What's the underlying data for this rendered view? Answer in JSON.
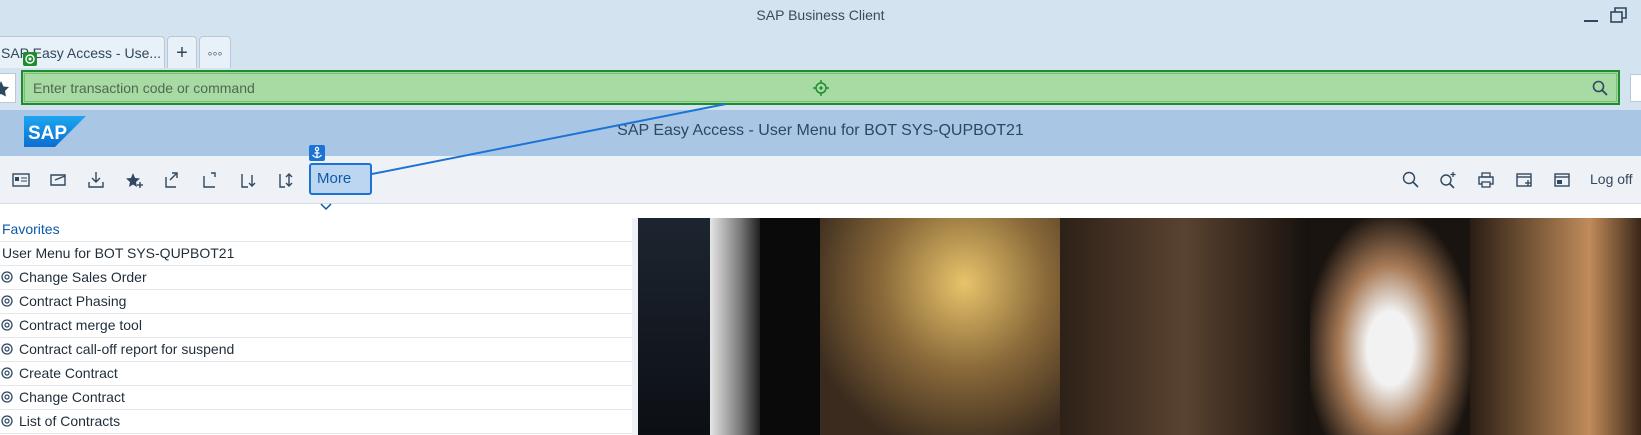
{
  "window": {
    "title": "SAP Business Client",
    "minimize_icon": "minimize-icon",
    "maximize_icon": "restore-icon"
  },
  "tabs": [
    {
      "label": "SAP Easy Access  -  Use..."
    },
    {
      "label": "+"
    },
    {
      "label": "◦◦◦"
    }
  ],
  "command": {
    "placeholder": "Enter transaction code or command",
    "search_icon": "search-icon",
    "target_icon": "target-icon"
  },
  "header": {
    "logo": "SAP",
    "title": "SAP Easy Access  -  User Menu for BOT SYS-QUPBOT21"
  },
  "toolbar": {
    "more_label": "More",
    "logoff_label": "Log off",
    "left_icons": [
      "user-menu-icon",
      "sap-menu-icon",
      "download-icon",
      "add-favorite-icon",
      "export-icon",
      "move-icon",
      "move-down-icon",
      "sort-icon"
    ],
    "right_icons": [
      "search-icon",
      "search-more-icon",
      "print-icon",
      "new-window-icon",
      "window-icon"
    ]
  },
  "tree": {
    "items": [
      {
        "label": "Favorites",
        "type": "folder"
      },
      {
        "label": "User Menu for BOT SYS-QUPBOT21",
        "type": "folder"
      },
      {
        "label": "Change Sales Order",
        "type": "transaction"
      },
      {
        "label": "Contract Phasing",
        "type": "transaction"
      },
      {
        "label": "Contract merge tool",
        "type": "transaction"
      },
      {
        "label": "Contract call-off report for suspend",
        "type": "transaction"
      },
      {
        "label": "Create Contract",
        "type": "transaction"
      },
      {
        "label": "Change Contract",
        "type": "transaction"
      },
      {
        "label": "List of Contracts",
        "type": "transaction"
      }
    ]
  },
  "colors": {
    "accent": "#1d73d4",
    "highlight_green": "#1f8d2d",
    "header_bg": "#a9c6e4"
  }
}
